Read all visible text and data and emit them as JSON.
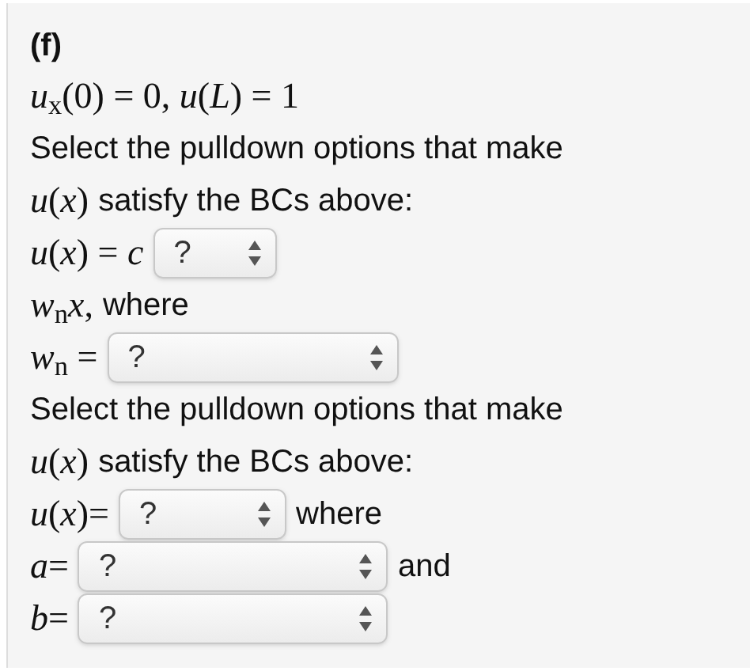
{
  "heading": "(f)",
  "lines": [
    {
      "items": [
        {
          "kind": "math",
          "text": "*u*$_{x}$(0) = 0, *u*(*L*) = 1"
        }
      ]
    },
    {
      "items": [
        {
          "kind": "text",
          "text": "Select the pulldown options that make"
        }
      ]
    },
    {
      "items": [
        {
          "kind": "math",
          "text": "*u*(*x*)"
        },
        {
          "kind": "text",
          "text": "satisfy the BCs above:"
        }
      ]
    },
    {
      "items": [
        {
          "kind": "math",
          "text": "*u*(*x*) = *c*"
        },
        {
          "kind": "select",
          "value": "?"
        }
      ]
    },
    {
      "items": [
        {
          "kind": "math",
          "text": "*w*$_{n}$*x*,"
        },
        {
          "kind": "text",
          "text": "where"
        }
      ]
    },
    {
      "items": [
        {
          "kind": "math",
          "text": "*w*$_{n}$ ="
        },
        {
          "kind": "select",
          "value": "?"
        }
      ]
    },
    {
      "items": [
        {
          "kind": "text",
          "text": "Select the pulldown options that make"
        }
      ]
    },
    {
      "items": [
        {
          "kind": "math",
          "text": "*u*(*x*)"
        },
        {
          "kind": "text",
          "text": "satisfy the BCs above:"
        }
      ]
    },
    {
      "items": [
        {
          "kind": "math",
          "text": "*u*(*x*)="
        },
        {
          "kind": "select",
          "value": "?"
        },
        {
          "kind": "text",
          "text": "where"
        }
      ]
    },
    {
      "items": [
        {
          "kind": "math",
          "text": "*a*="
        },
        {
          "kind": "select",
          "value": "?"
        },
        {
          "kind": "text",
          "text": "and"
        }
      ]
    },
    {
      "items": [
        {
          "kind": "math",
          "text": "*b*="
        },
        {
          "kind": "select",
          "value": "?"
        }
      ]
    }
  ]
}
